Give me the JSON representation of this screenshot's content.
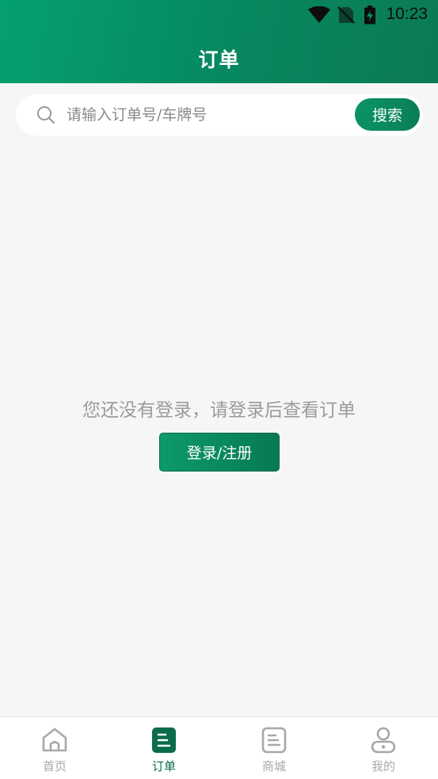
{
  "status_bar": {
    "time": "10:23"
  },
  "header": {
    "title": "订单"
  },
  "search": {
    "placeholder": "请输入订单号/车牌号",
    "value": "",
    "button_label": "搜索"
  },
  "empty_state": {
    "message": "您还没有登录，请登录后查看订单",
    "login_button_label": "登录/注册"
  },
  "tabs": [
    {
      "label": "首页",
      "icon": "home-icon",
      "active": false
    },
    {
      "label": "订单",
      "icon": "order-list-icon",
      "active": true
    },
    {
      "label": "商城",
      "icon": "mall-icon",
      "active": false
    },
    {
      "label": "我的",
      "icon": "profile-icon",
      "active": false
    }
  ],
  "colors": {
    "brand_green": "#07875f",
    "active_tab": "#0b6b4c",
    "inactive_tab": "#a8a8a8",
    "background": "#f6f6f6"
  }
}
